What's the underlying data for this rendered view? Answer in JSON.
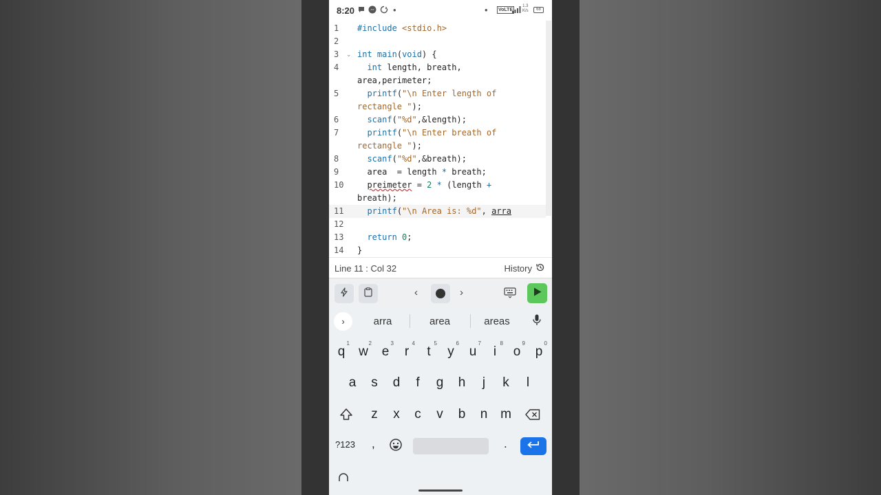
{
  "status_bar": {
    "time": "8:20",
    "dot": "•",
    "volte": "VoLTE",
    "speed_value": "1.3",
    "speed_unit": "K/s",
    "battery": "68"
  },
  "editor": {
    "lines": [
      {
        "no": "1",
        "text": "#include <stdio.h>"
      },
      {
        "no": "2",
        "text": ""
      },
      {
        "no": "3",
        "text": "int main(void) {"
      },
      {
        "no": "4",
        "text": "  int length, breath,"
      },
      {
        "no": "",
        "text": "area,perimeter;"
      },
      {
        "no": "5",
        "text": "  printf(\"\\n Enter length of"
      },
      {
        "no": "",
        "text": "rectangle \");"
      },
      {
        "no": "6",
        "text": "  scanf(\"%d\",&length);"
      },
      {
        "no": "7",
        "text": "  printf(\"\\n Enter breath of"
      },
      {
        "no": "",
        "text": "rectangle \");"
      },
      {
        "no": "8",
        "text": "  scanf(\"%d\",&breath);"
      },
      {
        "no": "9",
        "text": "  area  = length * breath;"
      },
      {
        "no": "10",
        "text": "  preimeter = 2 * (length +"
      },
      {
        "no": "",
        "text": "breath);"
      },
      {
        "no": "11",
        "text": "  printf(\"\\n Area is: %d\", arra"
      },
      {
        "no": "12",
        "text": ""
      },
      {
        "no": "13",
        "text": "  return 0;"
      },
      {
        "no": "14",
        "text": "}"
      }
    ]
  },
  "editor_status": {
    "cursor": "Line 11 : Col 32",
    "history": "History"
  },
  "toolbar": {
    "left_arrow": "‹",
    "right_arrow": "›"
  },
  "keyboard": {
    "suggestions": [
      "arra",
      "area",
      "areas"
    ],
    "expand_glyph": "›",
    "row1": [
      {
        "key": "q",
        "hint": "1"
      },
      {
        "key": "w",
        "hint": "2"
      },
      {
        "key": "e",
        "hint": "3"
      },
      {
        "key": "r",
        "hint": "4"
      },
      {
        "key": "t",
        "hint": "5"
      },
      {
        "key": "y",
        "hint": "6"
      },
      {
        "key": "u",
        "hint": "7"
      },
      {
        "key": "i",
        "hint": "8"
      },
      {
        "key": "o",
        "hint": "9"
      },
      {
        "key": "p",
        "hint": "0"
      }
    ],
    "row2": [
      "a",
      "s",
      "d",
      "f",
      "g",
      "h",
      "j",
      "k",
      "l"
    ],
    "row3": [
      "z",
      "x",
      "c",
      "v",
      "b",
      "n",
      "m"
    ],
    "symbols": "?123",
    "comma": ",",
    "period": "."
  },
  "colors": {
    "run_button": "#5cc85c",
    "enter_key": "#1a73e8",
    "keyword": "#1a6fa5",
    "string": "#a0662a",
    "number": "#098658"
  }
}
